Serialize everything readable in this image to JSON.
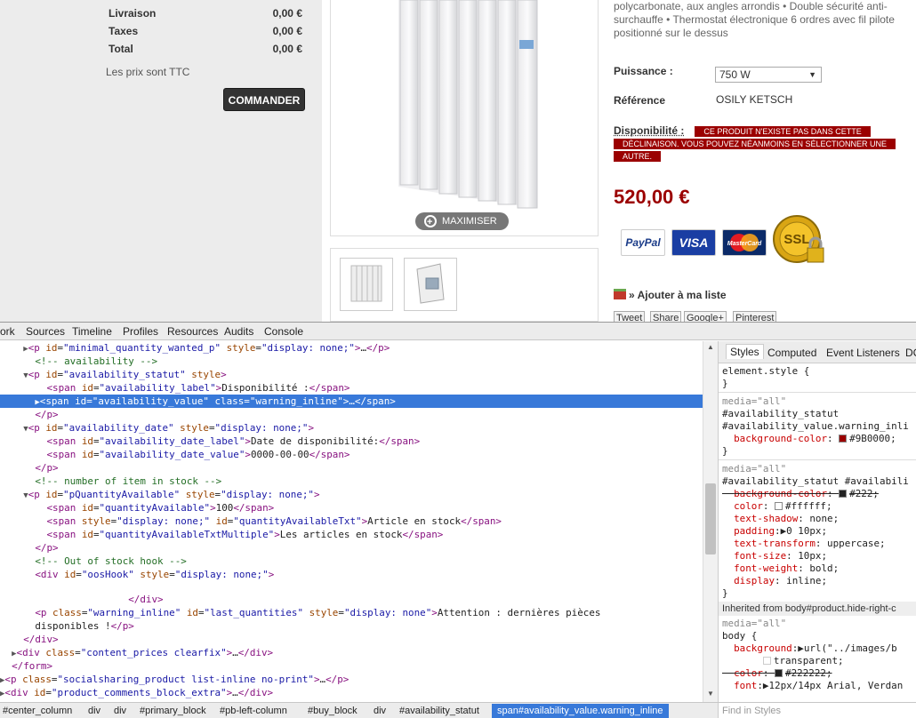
{
  "cart": {
    "rows": [
      {
        "label": "Livraison",
        "value": "0,00 €"
      },
      {
        "label": "Taxes",
        "value": "0,00 €"
      },
      {
        "label": "Total",
        "value": "0,00 €"
      }
    ],
    "ttc_note": "Les prix sont TTC",
    "order_button": "COMMANDER"
  },
  "gallery": {
    "maximize": "MAXIMISER"
  },
  "product": {
    "description": "polycarbonate, aux angles arrondis • Double sécurité anti-surchauffe • Thermostat électronique 6 ordres avec fil pilote positionné sur le dessus",
    "power_label": "Puissance :",
    "power_value": "750 W",
    "reference_label": "Référence",
    "reference_value": "OSILY KETSCH",
    "availability_label": "Disponibilité :",
    "availability_value": "Ce produit n'existe pas dans cette déclinaison. Vous pouvez néanmoins en sélectionner une autre.",
    "price": "520,00 €",
    "payments": {
      "paypal": "PayPal",
      "visa": "VISA",
      "mastercard": "MasterCard",
      "ssl": "SSL"
    },
    "wishlist": "» Ajouter à ma liste",
    "share": [
      "Tweet",
      "Share",
      "Google+",
      "Pinterest"
    ]
  },
  "devtools": {
    "tabs": [
      "ork",
      "Sources",
      "Timeline",
      "Profiles",
      "Resources",
      "Audits",
      "Console"
    ],
    "styles_tabs": [
      "Styles",
      "Computed",
      "Event Listeners",
      "DC"
    ],
    "inherited": "Inherited from body#product.hide-right-c",
    "find_placeholder": "Find in Styles",
    "breadcrumb": [
      "#center_column",
      "div",
      "div",
      "#primary_block",
      "#pb-left-column",
      "#buy_block",
      "div",
      "#availability_statut",
      "span#availability_value.warning_inline"
    ],
    "colors": {
      "warning_bg": "#9B0000",
      "old_bg": "#222",
      "text": "#ffffff",
      "body_color": "#222222",
      "selection": "#3879d9"
    }
  }
}
